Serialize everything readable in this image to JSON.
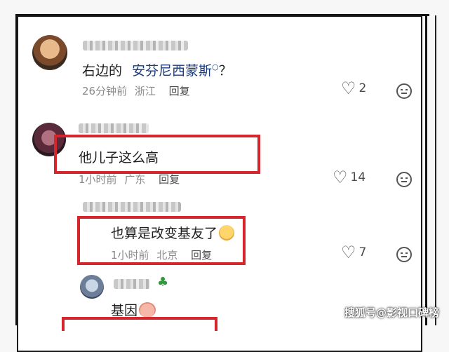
{
  "comments": [
    {
      "text": "右边的",
      "link": "安芬尼西蒙斯",
      "suffix": "？",
      "time": "26分钟前",
      "location": "浙江",
      "reply_label": "回复",
      "likes": "2"
    },
    {
      "text": "他儿子这么高",
      "time": "1小时前",
      "location": "广东",
      "reply_label": "回复",
      "likes": "14"
    },
    {
      "text": "也算是改变基友了",
      "time": "1小时前",
      "location": "北京",
      "reply_label": "回复",
      "likes": "7"
    },
    {
      "text": "基因"
    }
  ],
  "watermark": "搜狐号@影视口碑榜",
  "colors": {
    "highlight_box": "#d6262d",
    "link": "#1a3d7c"
  }
}
